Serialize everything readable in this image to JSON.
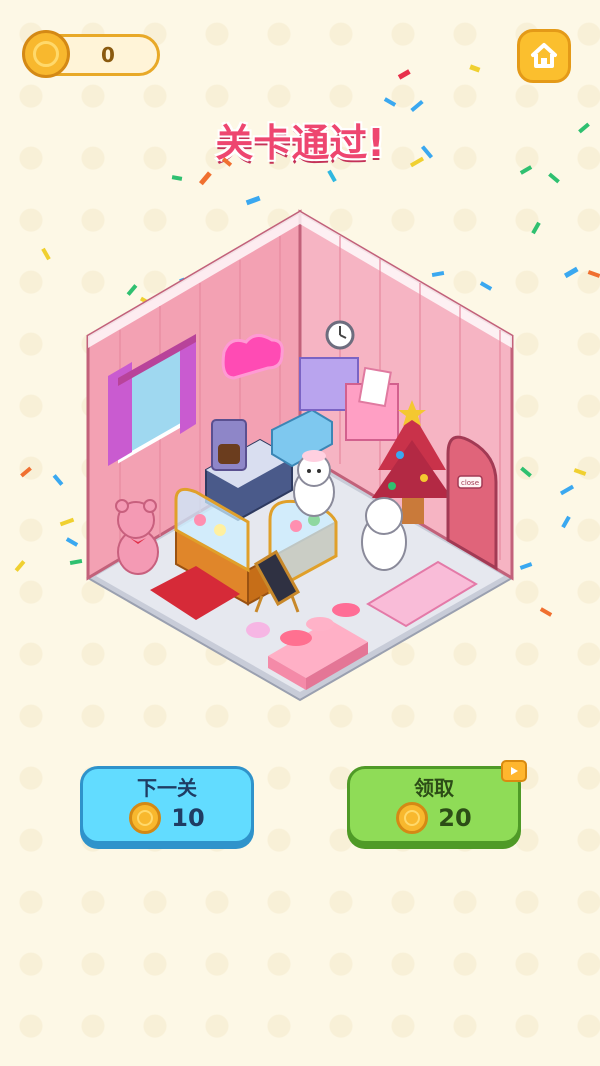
{
  "hud": {
    "coin_count": "0"
  },
  "banner": {
    "title": "关卡通过!"
  },
  "room": {
    "sign_text": "close"
  },
  "buttons": {
    "next": {
      "label": "下一关",
      "amount": "10"
    },
    "claim": {
      "label": "领取",
      "amount": "20"
    }
  },
  "colors": {
    "background": "#fdf8e6",
    "title": "#ee4670",
    "next_button": "#62dcff",
    "claim_button": "#8fdc57",
    "coin": "#f8b82e",
    "wall": "#f3a1b3"
  },
  "icons": [
    "coin-icon",
    "home-icon",
    "video-ad-icon"
  ]
}
